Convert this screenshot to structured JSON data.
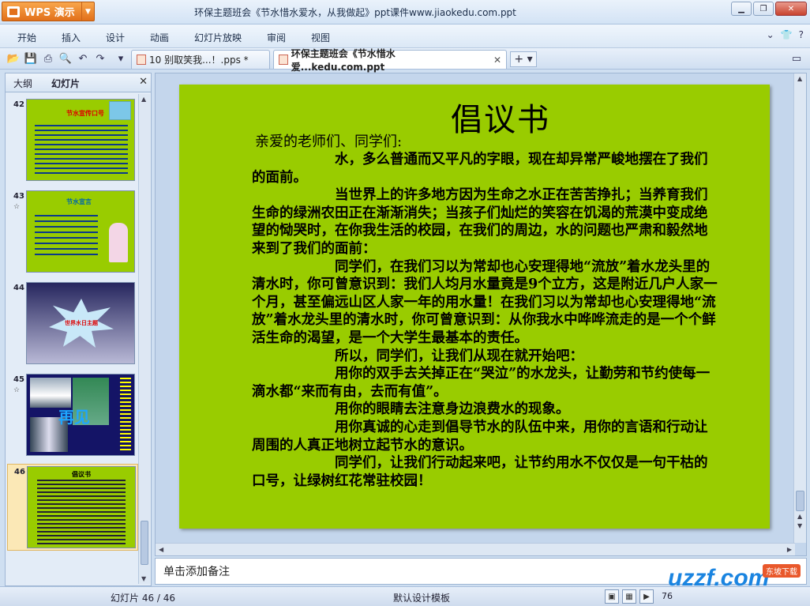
{
  "app": {
    "name": "WPS 演示",
    "document_title": "环保主题班会《节水惜水爱水，从我做起》ppt课件www.jiaokedu.com.ppt"
  },
  "menu": {
    "items": [
      "开始",
      "插入",
      "设计",
      "动画",
      "幻灯片放映",
      "审阅",
      "视图"
    ]
  },
  "tabs": [
    {
      "label": "10 别取笑我...！.pps *",
      "active": false
    },
    {
      "label": "环保主题班会《节水惜水爱...kedu.com.ppt",
      "active": true
    }
  ],
  "panel": {
    "tabs": [
      "大纲",
      "幻灯片"
    ],
    "active_tab": "幻灯片"
  },
  "thumbnails": [
    {
      "num": "42",
      "title": "节水宣传口号",
      "bg": "#99cc00"
    },
    {
      "num": "43",
      "title": "节水宣言",
      "bg": "#99cc00",
      "star": "☆"
    },
    {
      "num": "44",
      "title": "世界水日主题",
      "bg": "#2b2b6b"
    },
    {
      "num": "45",
      "title": "再见",
      "bg": "#141466",
      "star": "☆"
    },
    {
      "num": "46",
      "title": "倡议书",
      "bg": "#99cc00"
    }
  ],
  "slide": {
    "title": "倡议书",
    "salutation": "亲爱的老师们、同学们:",
    "paragraphs": [
      "水，多么普通而又平凡的字眼，现在却异常严峻地摆在了我们的面前。",
      "当世界上的许多地方因为生命之水正在苦苦挣扎；当养育我们生命的绿洲农田正在渐渐消失；当孩子们灿烂的笑容在饥渴的荒漠中变成绝望的恸哭时，在你我生活的校园，在我们的周边，水的问题也严肃和毅然地来到了我们的面前：",
      "同学们，在我们习以为常却也心安理得地“流放”着水龙头里的清水时，你可曾意识到：我们人均月水量竟是9个立方，这是附近几户人家一个月，甚至偏远山区人家一年的用水量！在我们习以为常却也心安理得地“流放”着水龙头里的清水时，你可曾意识到：从你我水中哗哗流走的是一个个鲜活生命的渴望，是一个大学生最基本的责任。",
      "所以，同学们，让我们从现在就开始吧：",
      "用你的双手去关掉正在“哭泣”的水龙头，让勤劳和节约使每一滴水都“来而有由，去而有值”。",
      "用你的眼睛去注意身边浪费水的现象。",
      "用你真诚的心走到倡导节水的队伍中来，用你的言语和行动让周围的人真正地树立起节水的意识。",
      "同学们，让我们行动起来吧，让节约用水不仅仅是一句干枯的口号，让绿树红花常驻校园！"
    ]
  },
  "notes": {
    "placeholder": "单击添加备注"
  },
  "status": {
    "slide_counter": "幻灯片 46 / 46",
    "template": "默认设计模板",
    "zoom": "76"
  },
  "watermark": {
    "logo": "uzzf.com",
    "sub": "东坡下载"
  }
}
